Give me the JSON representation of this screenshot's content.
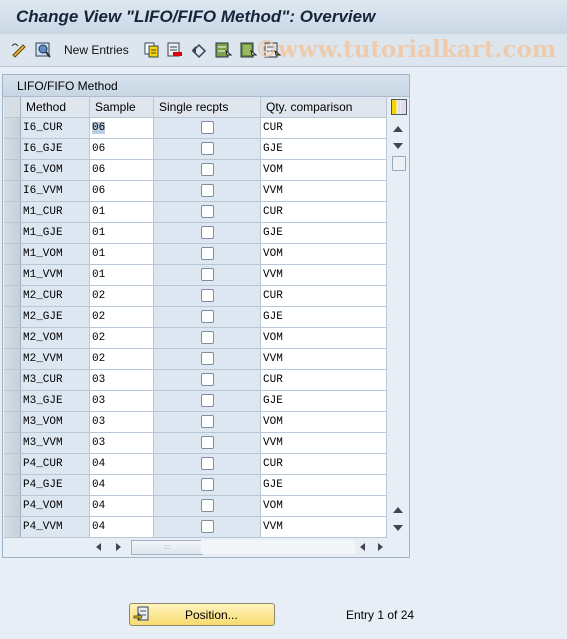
{
  "window": {
    "title": "Change View \"LIFO/FIFO Method\": Overview"
  },
  "toolbar": {
    "items": [
      {
        "icon": "display-change-icon"
      },
      {
        "icon": "details-icon"
      },
      {
        "label": "New Entries"
      },
      {
        "icon": "copy-as-icon"
      },
      {
        "icon": "delete-icon"
      },
      {
        "icon": "undo-change-icon"
      },
      {
        "icon": "select-all-icon"
      },
      {
        "icon": "select-block-icon"
      },
      {
        "icon": "deselect-all-icon"
      }
    ],
    "watermark": "©www.tutorialkart.com"
  },
  "panel": {
    "title": "LIFO/FIFO Method"
  },
  "table": {
    "columns": [
      "Method",
      "Sample",
      "Single recpts",
      "Qty. comparison"
    ],
    "rows": [
      {
        "method": "I6_CUR",
        "sample": "06",
        "single": false,
        "qty": "CUR"
      },
      {
        "method": "I6_GJE",
        "sample": "06",
        "single": false,
        "qty": "GJE"
      },
      {
        "method": "I6_VOM",
        "sample": "06",
        "single": false,
        "qty": "VOM"
      },
      {
        "method": "I6_VVM",
        "sample": "06",
        "single": false,
        "qty": "VVM"
      },
      {
        "method": "M1_CUR",
        "sample": "01",
        "single": false,
        "qty": "CUR"
      },
      {
        "method": "M1_GJE",
        "sample": "01",
        "single": false,
        "qty": "GJE"
      },
      {
        "method": "M1_VOM",
        "sample": "01",
        "single": false,
        "qty": "VOM"
      },
      {
        "method": "M1_VVM",
        "sample": "01",
        "single": false,
        "qty": "VVM"
      },
      {
        "method": "M2_CUR",
        "sample": "02",
        "single": false,
        "qty": "CUR"
      },
      {
        "method": "M2_GJE",
        "sample": "02",
        "single": false,
        "qty": "GJE"
      },
      {
        "method": "M2_VOM",
        "sample": "02",
        "single": false,
        "qty": "VOM"
      },
      {
        "method": "M2_VVM",
        "sample": "02",
        "single": false,
        "qty": "VVM"
      },
      {
        "method": "M3_CUR",
        "sample": "03",
        "single": false,
        "qty": "CUR"
      },
      {
        "method": "M3_GJE",
        "sample": "03",
        "single": false,
        "qty": "GJE"
      },
      {
        "method": "M3_VOM",
        "sample": "03",
        "single": false,
        "qty": "VOM"
      },
      {
        "method": "M3_VVM",
        "sample": "03",
        "single": false,
        "qty": "VVM"
      },
      {
        "method": "P4_CUR",
        "sample": "04",
        "single": false,
        "qty": "CUR"
      },
      {
        "method": "P4_GJE",
        "sample": "04",
        "single": false,
        "qty": "GJE"
      },
      {
        "method": "P4_VOM",
        "sample": "04",
        "single": false,
        "qty": "VOM"
      },
      {
        "method": "P4_VVM",
        "sample": "04",
        "single": false,
        "qty": "VVM"
      }
    ]
  },
  "footer": {
    "position_label": "Position...",
    "entry_text": "Entry 1 of 24"
  }
}
